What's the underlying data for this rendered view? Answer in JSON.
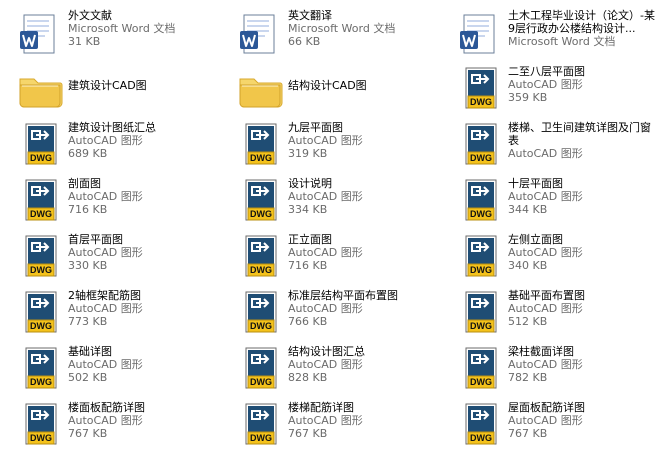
{
  "top_title": "",
  "files": [
    {
      "name": "外文文献",
      "type": "Microsoft Word 文档",
      "size": "31 KB",
      "icon": "word-doc-icon"
    },
    {
      "name": "英文翻译",
      "type": "Microsoft Word 文档",
      "size": "66 KB",
      "icon": "word-doc-icon"
    },
    {
      "name": "土木工程毕业设计（论文）-某9层行政办公楼结构设计...",
      "type": "Microsoft Word 文档",
      "size": "",
      "icon": "word-doc-icon"
    },
    {
      "name": "建筑设计CAD图",
      "type": "",
      "size": "",
      "icon": "folder-icon"
    },
    {
      "name": "结构设计CAD图",
      "type": "",
      "size": "",
      "icon": "folder-icon"
    },
    {
      "name": "二至八层平面图",
      "type": "AutoCAD 图形",
      "size": "359 KB",
      "icon": "dwg-file-icon"
    },
    {
      "name": "建筑设计图纸汇总",
      "type": "AutoCAD 图形",
      "size": "689 KB",
      "icon": "dwg-file-icon"
    },
    {
      "name": "九层平面图",
      "type": "AutoCAD 图形",
      "size": "319 KB",
      "icon": "dwg-file-icon"
    },
    {
      "name": "楼梯、卫生间建筑详图及门窗表",
      "type": "AutoCAD 图形",
      "size": "",
      "icon": "dwg-file-icon"
    },
    {
      "name": "剖面图",
      "type": "AutoCAD 图形",
      "size": "716 KB",
      "icon": "dwg-file-icon"
    },
    {
      "name": "设计说明",
      "type": "AutoCAD 图形",
      "size": "334 KB",
      "icon": "dwg-file-icon"
    },
    {
      "name": "十层平面图",
      "type": "AutoCAD 图形",
      "size": "344 KB",
      "icon": "dwg-file-icon"
    },
    {
      "name": "首层平面图",
      "type": "AutoCAD 图形",
      "size": "330 KB",
      "icon": "dwg-file-icon"
    },
    {
      "name": "正立面图",
      "type": "AutoCAD 图形",
      "size": "716 KB",
      "icon": "dwg-file-icon"
    },
    {
      "name": "左侧立面图",
      "type": "AutoCAD 图形",
      "size": "340 KB",
      "icon": "dwg-file-icon"
    },
    {
      "name": "2轴框架配筋图",
      "type": "AutoCAD 图形",
      "size": "773 KB",
      "icon": "dwg-file-icon"
    },
    {
      "name": "标准层结构平面布置图",
      "type": "AutoCAD 图形",
      "size": "766 KB",
      "icon": "dwg-file-icon"
    },
    {
      "name": "基础平面布置图",
      "type": "AutoCAD 图形",
      "size": "512 KB",
      "icon": "dwg-file-icon"
    },
    {
      "name": "基础详图",
      "type": "AutoCAD 图形",
      "size": "502 KB",
      "icon": "dwg-file-icon"
    },
    {
      "name": "结构设计图汇总",
      "type": "AutoCAD 图形",
      "size": "828 KB",
      "icon": "dwg-file-icon"
    },
    {
      "name": "梁柱截面详图",
      "type": "AutoCAD 图形",
      "size": "782 KB",
      "icon": "dwg-file-icon"
    },
    {
      "name": "楼面板配筋详图",
      "type": "AutoCAD 图形",
      "size": "767 KB",
      "icon": "dwg-file-icon"
    },
    {
      "name": "楼梯配筋详图",
      "type": "AutoCAD 图形",
      "size": "767 KB",
      "icon": "dwg-file-icon"
    },
    {
      "name": "屋面板配筋详图",
      "type": "AutoCAD 图形",
      "size": "767 KB",
      "icon": "dwg-file-icon"
    }
  ],
  "colors": {
    "folder_top": "#f6d66b",
    "folder_body": "#f1c64a",
    "dwg_bg": "#1f4d74",
    "dwg_yellow": "#f4c21b",
    "word_blue": "#2b5797",
    "type_text": "#6b6b6b"
  }
}
